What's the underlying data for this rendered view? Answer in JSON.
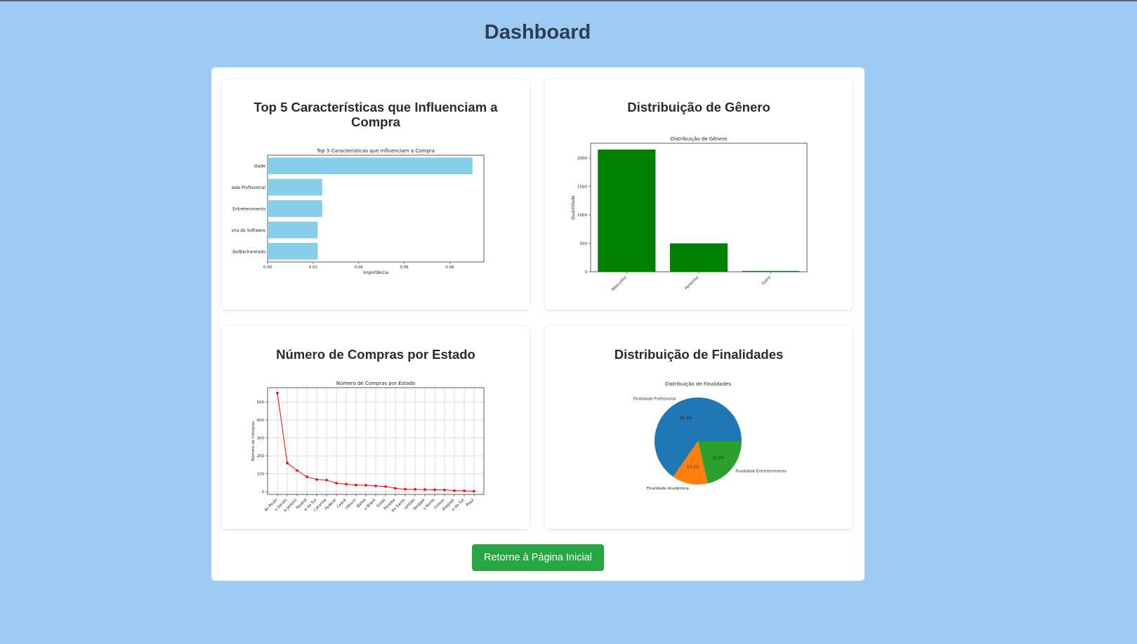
{
  "page": {
    "title": "Dashboard"
  },
  "cards": {
    "features": {
      "heading": "Top 5 Características que Influenciam a Compra"
    },
    "gender": {
      "heading": "Distribuição de Gênero"
    },
    "states": {
      "heading": "Número de Compras por Estado"
    },
    "purposes": {
      "heading": "Distribuição de Finalidades"
    }
  },
  "button": {
    "label": "Retorne à Página Inicial"
  },
  "chart_data": [
    {
      "type": "bar",
      "orientation": "horizontal",
      "title": "Top 5 Características que Influenciam a Compra",
      "xlabel": "Importância",
      "ylabel": "",
      "categories": [
        "Idade",
        "Finalidade Profissional",
        "Finalidade Entretenimento",
        "Engenharia de Software",
        "Graduação/Bacharelado"
      ],
      "category_labels_visible": [
        "idade",
        "idade Profissional",
        "e Entretenimento",
        "eria de Software",
        "ção/Bacharelado"
      ],
      "values": [
        0.09,
        0.024,
        0.024,
        0.022,
        0.022
      ],
      "xlim": [
        0,
        0.095
      ],
      "xticks": [
        "0.00",
        "0.02",
        "0.04",
        "0.06",
        "0.08"
      ],
      "color": "#87ceeb"
    },
    {
      "type": "bar",
      "title": "Distribuição de Gênero",
      "xlabel": "",
      "ylabel": "Quantidade",
      "categories": [
        "Masculino",
        "Feminino",
        "Outro"
      ],
      "values": [
        2150,
        500,
        15
      ],
      "ylim": [
        0,
        2260
      ],
      "yticks": [
        "0",
        "500",
        "1000",
        "1500",
        "2000"
      ],
      "color": "#008000"
    },
    {
      "type": "line",
      "title": "Número de Compras por Estado",
      "xlabel": "",
      "ylabel": "Número de Compras",
      "categories": [
        "São Paulo",
        "Minas Gerais",
        "Rio de Janeiro",
        "Paraná",
        "Rio Grande do Sul",
        "Santa Catarina",
        "Distrito Federal",
        "Ceará",
        "Pernambuco",
        "Bahia",
        "Espírito Santo Brasil",
        "Goiás",
        "Paraíba",
        "Espírito Santo",
        "Maranhão",
        "Sergipe",
        "Rio Grande do Norte",
        "Mato Grosso",
        "Alagoas",
        "Mato Grosso do Sul",
        "Piauí"
      ],
      "tick_labels_visible": [
        "ão Paulo",
        "s Gerais",
        "e Janeiro",
        "Paraná",
        "e do Sul",
        "Catarina",
        "Federal",
        "Ceará",
        "mbuco",
        "Bahia",
        "o Brasil",
        "Goiás",
        "Paraíba",
        "ito Santo",
        "ranhão",
        "Sergipe",
        "o Norte",
        "Grosso",
        "Alagoas",
        "o do Sul",
        "Piauí"
      ],
      "values": [
        550,
        160,
        118,
        83,
        68,
        65,
        48,
        42,
        37,
        36,
        32,
        29,
        19,
        14,
        13,
        12,
        11,
        10,
        6,
        5,
        3
      ],
      "ylim": [
        -15,
        580
      ],
      "yticks": [
        "0",
        "100",
        "200",
        "300",
        "400",
        "500"
      ],
      "grid": true,
      "color": "#ff0000"
    },
    {
      "type": "pie",
      "title": "Distribuição de Finalidades",
      "labels": [
        "Finalidade Profissional",
        "Finalidade Acadêmica",
        "Finalidade Entretenimento"
      ],
      "values": [
        65.3,
        13.2,
        21.5
      ],
      "pct_labels": [
        "65.3%",
        "13.2%",
        "21.5%"
      ],
      "colors": [
        "#1f77b4",
        "#ff7f0e",
        "#2ca02c"
      ]
    }
  ]
}
